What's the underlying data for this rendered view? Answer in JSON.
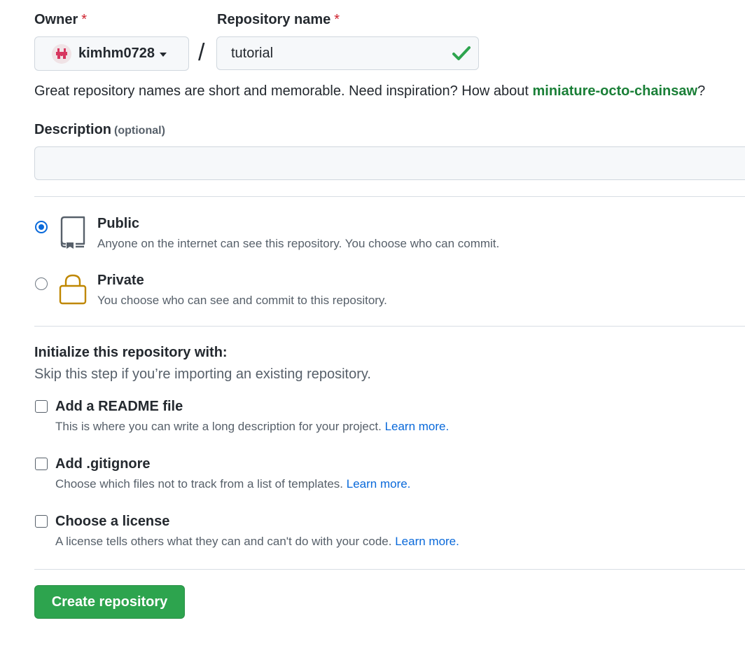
{
  "owner": {
    "label": "Owner",
    "required_mark": "*",
    "value": "kimhm0728",
    "avatar_icon": "identicon-avatar",
    "avatar_color": "#d7365f"
  },
  "repository": {
    "label": "Repository name",
    "required_mark": "*",
    "value": "tutorial",
    "separator": "/",
    "valid_icon": "check-icon",
    "valid_color": "#2da44e"
  },
  "hint": {
    "text_before": "Great repository names are short and memorable. Need inspiration? How about ",
    "suggestion": "miniature-octo-chainsaw",
    "text_after": "?"
  },
  "description": {
    "label": "Description",
    "optional_label": "(optional)",
    "value": "",
    "placeholder": ""
  },
  "visibility": {
    "selected": "public",
    "options": [
      {
        "id": "public",
        "title": "Public",
        "description": "Anyone on the internet can see this repository. You choose who can commit.",
        "icon": "repo-icon",
        "icon_color": "#57606a"
      },
      {
        "id": "private",
        "title": "Private",
        "description": "You choose who can see and commit to this repository.",
        "icon": "lock-icon",
        "icon_color": "#bf8700"
      }
    ]
  },
  "initialize": {
    "title": "Initialize this repository with:",
    "subtitle": "Skip this step if you’re importing an existing repository.",
    "options": [
      {
        "title": "Add a README file",
        "description": "This is where you can write a long description for your project.",
        "link": "Learn more.",
        "checked": false
      },
      {
        "title": "Add .gitignore",
        "description": "Choose which files not to track from a list of templates.",
        "link": "Learn more.",
        "checked": false
      },
      {
        "title": "Choose a license",
        "description": "A license tells others what they can and can't do with your code.",
        "link": "Learn more.",
        "checked": false
      }
    ]
  },
  "submit": {
    "label": "Create repository",
    "color": "#2da44e"
  },
  "colors": {
    "link": "#0969da",
    "suggestion": "#1a7f37",
    "required": "#cf222e",
    "radio_selected": "#0969da"
  }
}
